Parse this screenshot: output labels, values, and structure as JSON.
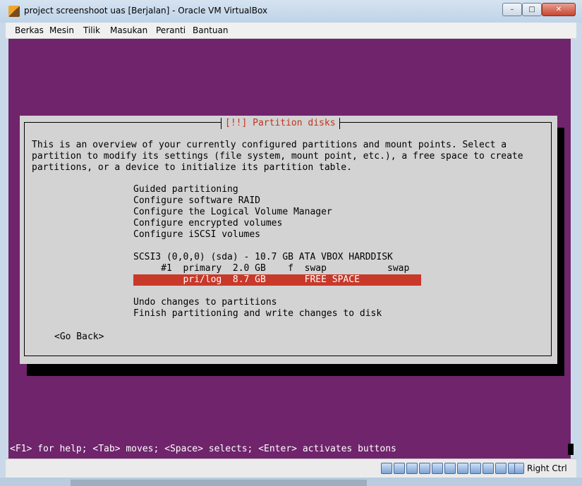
{
  "window": {
    "title": "project screenshoot uas [Berjalan] - Oracle VM VirtualBox",
    "buttons": {
      "minimize": "–",
      "maximize": "□",
      "close": "✕"
    }
  },
  "menubar": {
    "items": [
      "Berkas",
      "Mesin",
      "Tilik",
      "Masukan",
      "Peranti",
      "Bantuan"
    ]
  },
  "installer": {
    "dialog_title": "[!!] Partition disks",
    "description": [
      "This is an overview of your currently configured partitions and mount points. Select a",
      "partition to modify its settings (file system, mount point, etc.), a free space to create",
      "partitions, or a device to initialize its partition table."
    ],
    "options": [
      "Guided partitioning",
      "Configure software RAID",
      "Configure the Logical Volume Manager",
      "Configure encrypted volumes",
      "Configure iSCSI volumes"
    ],
    "disk": "SCSI3 (0,0,0) (sda) - 10.7 GB ATA VBOX HARDDISK",
    "partitions": [
      "     #1  primary  2.0 GB    f  swap           swap",
      "         pri/log  8.7 GB       FREE SPACE"
    ],
    "selected_partition_index": 1,
    "actions": [
      "Undo changes to partitions",
      "Finish partitioning and write changes to disk"
    ],
    "go_back": "<Go Back>",
    "help_line": "<F1> for help; <Tab> moves; <Space> selects; <Enter> activates buttons",
    "colors": {
      "background": "#6f246c",
      "dialog": "#d3d3d3",
      "highlight": "#c8392a",
      "title": "#c3331f"
    }
  },
  "statusbar": {
    "icons": [
      "hard-disk-icon",
      "optical-drive-icon",
      "usb-icon",
      "network-icon",
      "pencil-icon",
      "folder-icon",
      "display-icon",
      "shared-folder-icon",
      "capture-icon",
      "video-capture-icon",
      "recording-icon",
      "keyboard-capture-icon"
    ],
    "host_key": "Right Ctrl"
  }
}
